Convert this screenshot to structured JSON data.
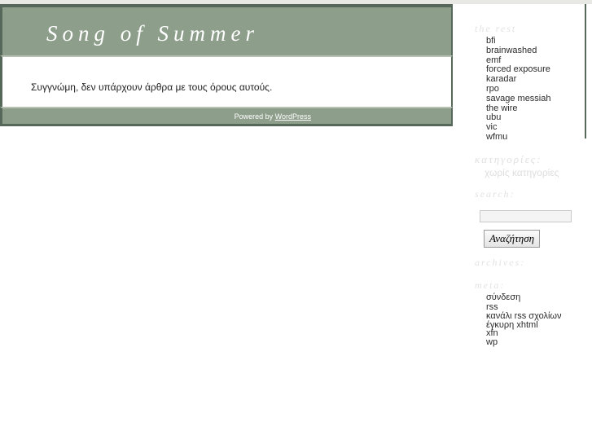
{
  "site": {
    "title": "Song of Summer"
  },
  "main": {
    "no_posts_message": "Συγγνώμη, δεν υπάρχουν άρθρα με τους όρους αυτούς."
  },
  "footer": {
    "powered_by_prefix": "Powered by ",
    "wordpress_label": "WordPress"
  },
  "sidebar": {
    "the_rest": {
      "heading": "the rest",
      "links": [
        "bfi",
        "brainwashed",
        "emf",
        "forced exposure",
        "karadar",
        "rpo",
        "savage messiah",
        "the wire",
        "ubu",
        "vic",
        "wfmu"
      ]
    },
    "categories": {
      "heading": "κατηγορίες:",
      "items": [
        "χωρίς κατηγορίες"
      ]
    },
    "search": {
      "heading": "search:",
      "input_value": "",
      "submit_label": "Αναζήτηση"
    },
    "archives": {
      "heading": "archives:",
      "items": []
    },
    "meta": {
      "heading": "meta:",
      "items": [
        "σύνδεση",
        "rss",
        "κανάλι rss σχολίων",
        "έγκυρη xhtml",
        "xfn",
        "wp"
      ]
    }
  },
  "colors": {
    "header_green": "#8d9e8b",
    "border_green": "#56685a",
    "heading_gray": "#e2e2e2",
    "top_strip": "#e8e8e4"
  }
}
